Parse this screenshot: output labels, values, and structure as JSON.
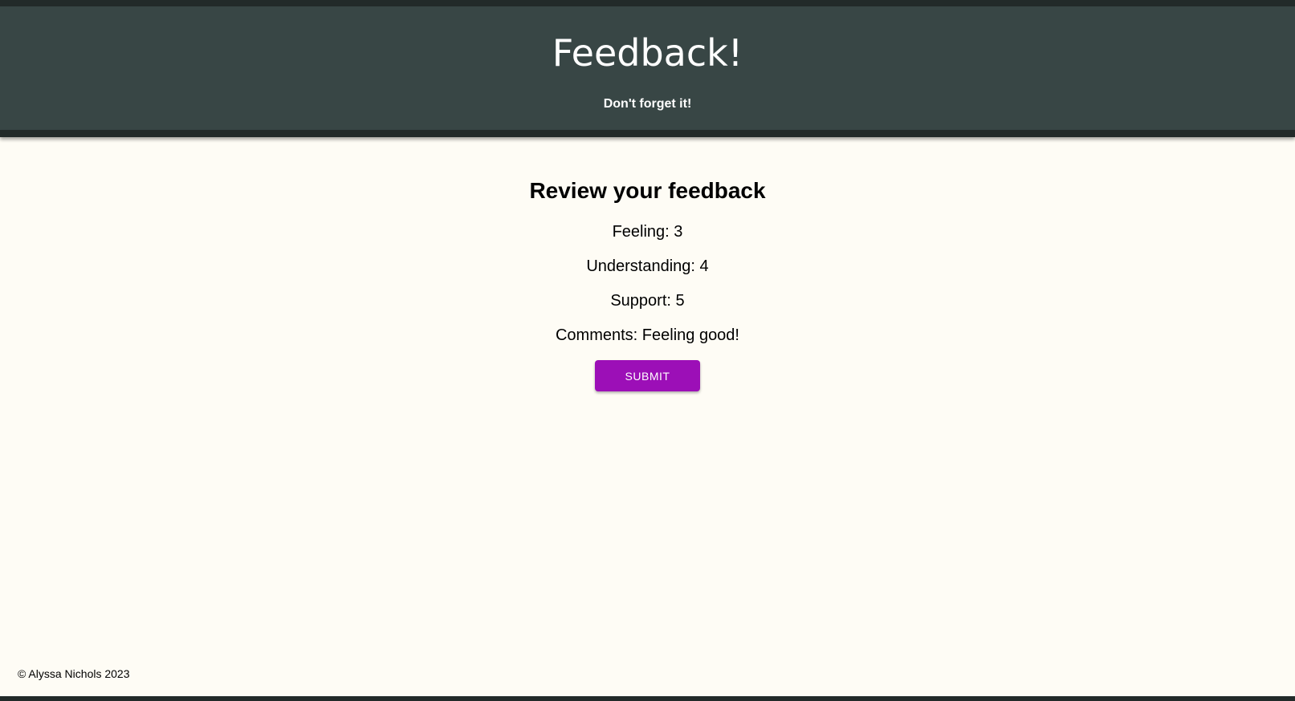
{
  "header": {
    "title": "Feedback!",
    "subtitle": "Don't forget it!"
  },
  "review": {
    "heading": "Review your feedback",
    "feeling": "Feeling: 3",
    "understanding": "Understanding: 4",
    "support": "Support: 5",
    "comments": "Comments: Feeling good!",
    "submit_label": "SUBMIT"
  },
  "footer": {
    "copyright": "© Alyssa Nichols 2023"
  },
  "colors": {
    "header_bg": "#384645",
    "header_dark": "#222a29",
    "page_bg": "#fefcf5",
    "submit_bg": "#9c0fb7"
  }
}
